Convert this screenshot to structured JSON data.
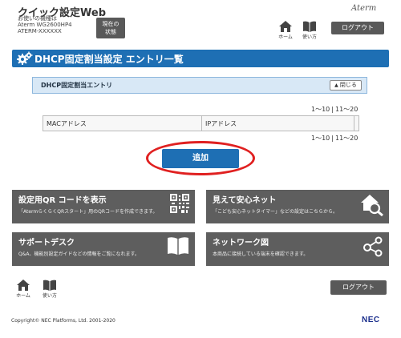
{
  "header": {
    "title": "クイック設定Web",
    "device_lines": [
      "お使いの機種は",
      "Aterm WG2600HP4",
      "ATERM-XXXXXX"
    ],
    "state_button": [
      "現在の",
      "状態"
    ],
    "brand_logo": "Aterm",
    "home_label": "ホーム",
    "manual_label": "使い方",
    "logout_label": "ログアウト"
  },
  "section": {
    "title": "DHCP固定割当設定 エントリ一覧"
  },
  "panel": {
    "title": "DHCP固定割当エントリ",
    "close_label": "閉じる",
    "pager": {
      "range1": "1〜10",
      "separator": "|",
      "range2": "11〜20"
    },
    "table": {
      "headers": [
        "MACアドレス",
        "IPアドレス",
        ""
      ]
    },
    "add_label": "追加"
  },
  "tiles": [
    {
      "title": "設定用QR コードを表示",
      "desc": "「AtermらくらくQRスタート」用のQRコードを作成できます。",
      "icon": "qr-code-icon"
    },
    {
      "title": "見えて安心ネット",
      "desc": "「こども安心ネットタイマー」などの設定はこちらから。",
      "icon": "home-search-icon"
    },
    {
      "title": "サポートデスク",
      "desc": "Q&A、機能別設定ガイドなどの情報をご覧になれます。",
      "icon": "book-icon"
    },
    {
      "title": "ネットワーク図",
      "desc": "本商品に接続している端末を確認できます。",
      "icon": "network-nodes-icon"
    }
  ],
  "footer": {
    "home_label": "ホーム",
    "manual_label": "使い方",
    "logout_label": "ログアウト",
    "copyright": "Copyright© NEC Platforms, Ltd. 2001-2020",
    "company_logo": "NEC"
  },
  "colors": {
    "accent_blue": "#1e6fb4",
    "tile_gray": "#5e5e5e",
    "highlight_red": "#e02020"
  }
}
